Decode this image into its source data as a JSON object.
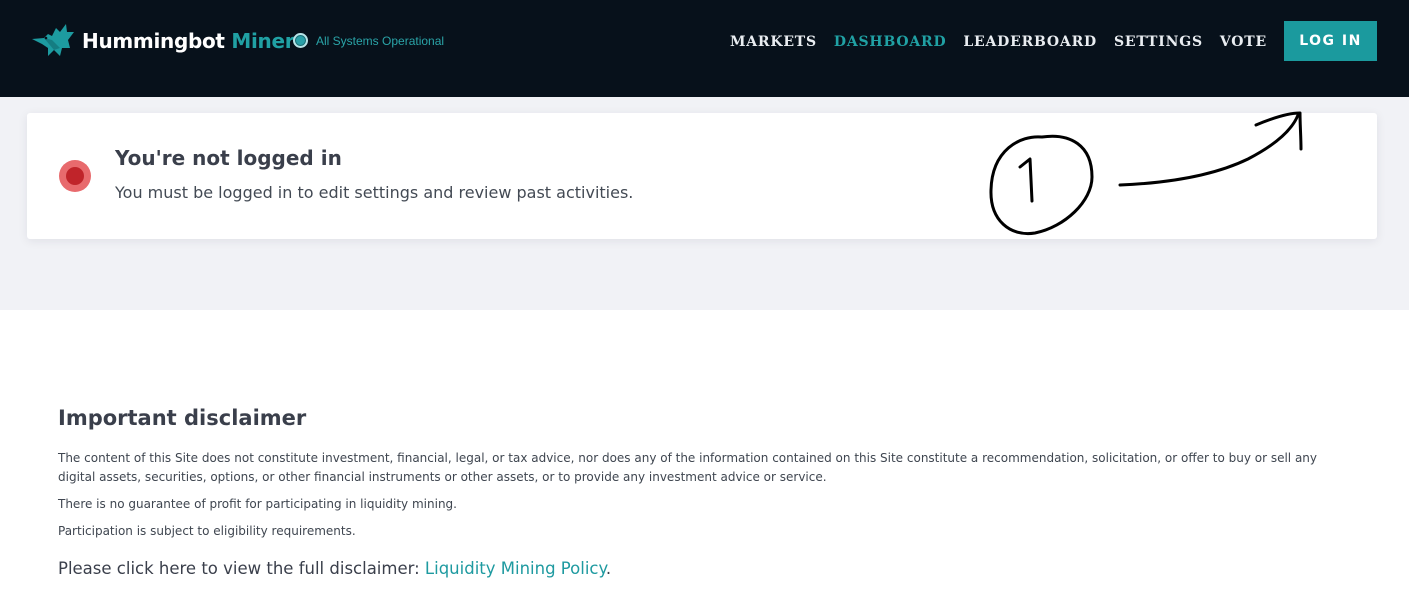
{
  "header": {
    "brand_main": "Hummingbot",
    "brand_accent": "Miner",
    "status_text": "All Systems Operational",
    "nav": [
      {
        "label": "MARKETS",
        "active": false
      },
      {
        "label": "DASHBOARD",
        "active": true
      },
      {
        "label": "LEADERBOARD",
        "active": false
      },
      {
        "label": "SETTINGS",
        "active": false
      },
      {
        "label": "VOTE",
        "active": false
      }
    ],
    "login_label": "LOG IN"
  },
  "alert": {
    "title": "You're not logged in",
    "message": "You must be logged in to edit settings and review past activities."
  },
  "annotation": {
    "number": "1"
  },
  "disclaimer": {
    "title": "Important disclaimer",
    "paragraph1": "The content of this Site does not constitute investment, financial, legal, or tax advice, nor does any of the information contained on this Site constitute a recommendation, solicitation, or offer to buy or sell any digital assets, securities, options, or other financial instruments or other assets, or to provide any investment advice or service.",
    "paragraph2": "There is no guarantee of profit for participating in liquidity mining.",
    "paragraph3": "Participation is subject to eligibility requirements.",
    "link_prefix": "Please click here to view the full disclaimer: ",
    "link_label": "Liquidity Mining Policy",
    "link_suffix": "."
  },
  "colors": {
    "header_bg": "#07111b",
    "accent": "#20a1a4",
    "alert": "#c0242a",
    "band_bg": "#f1f2f6"
  },
  "icons": {
    "logo": "hummingbird-logo-icon",
    "status": "status-dot-icon",
    "alert": "alert-dot-icon"
  }
}
